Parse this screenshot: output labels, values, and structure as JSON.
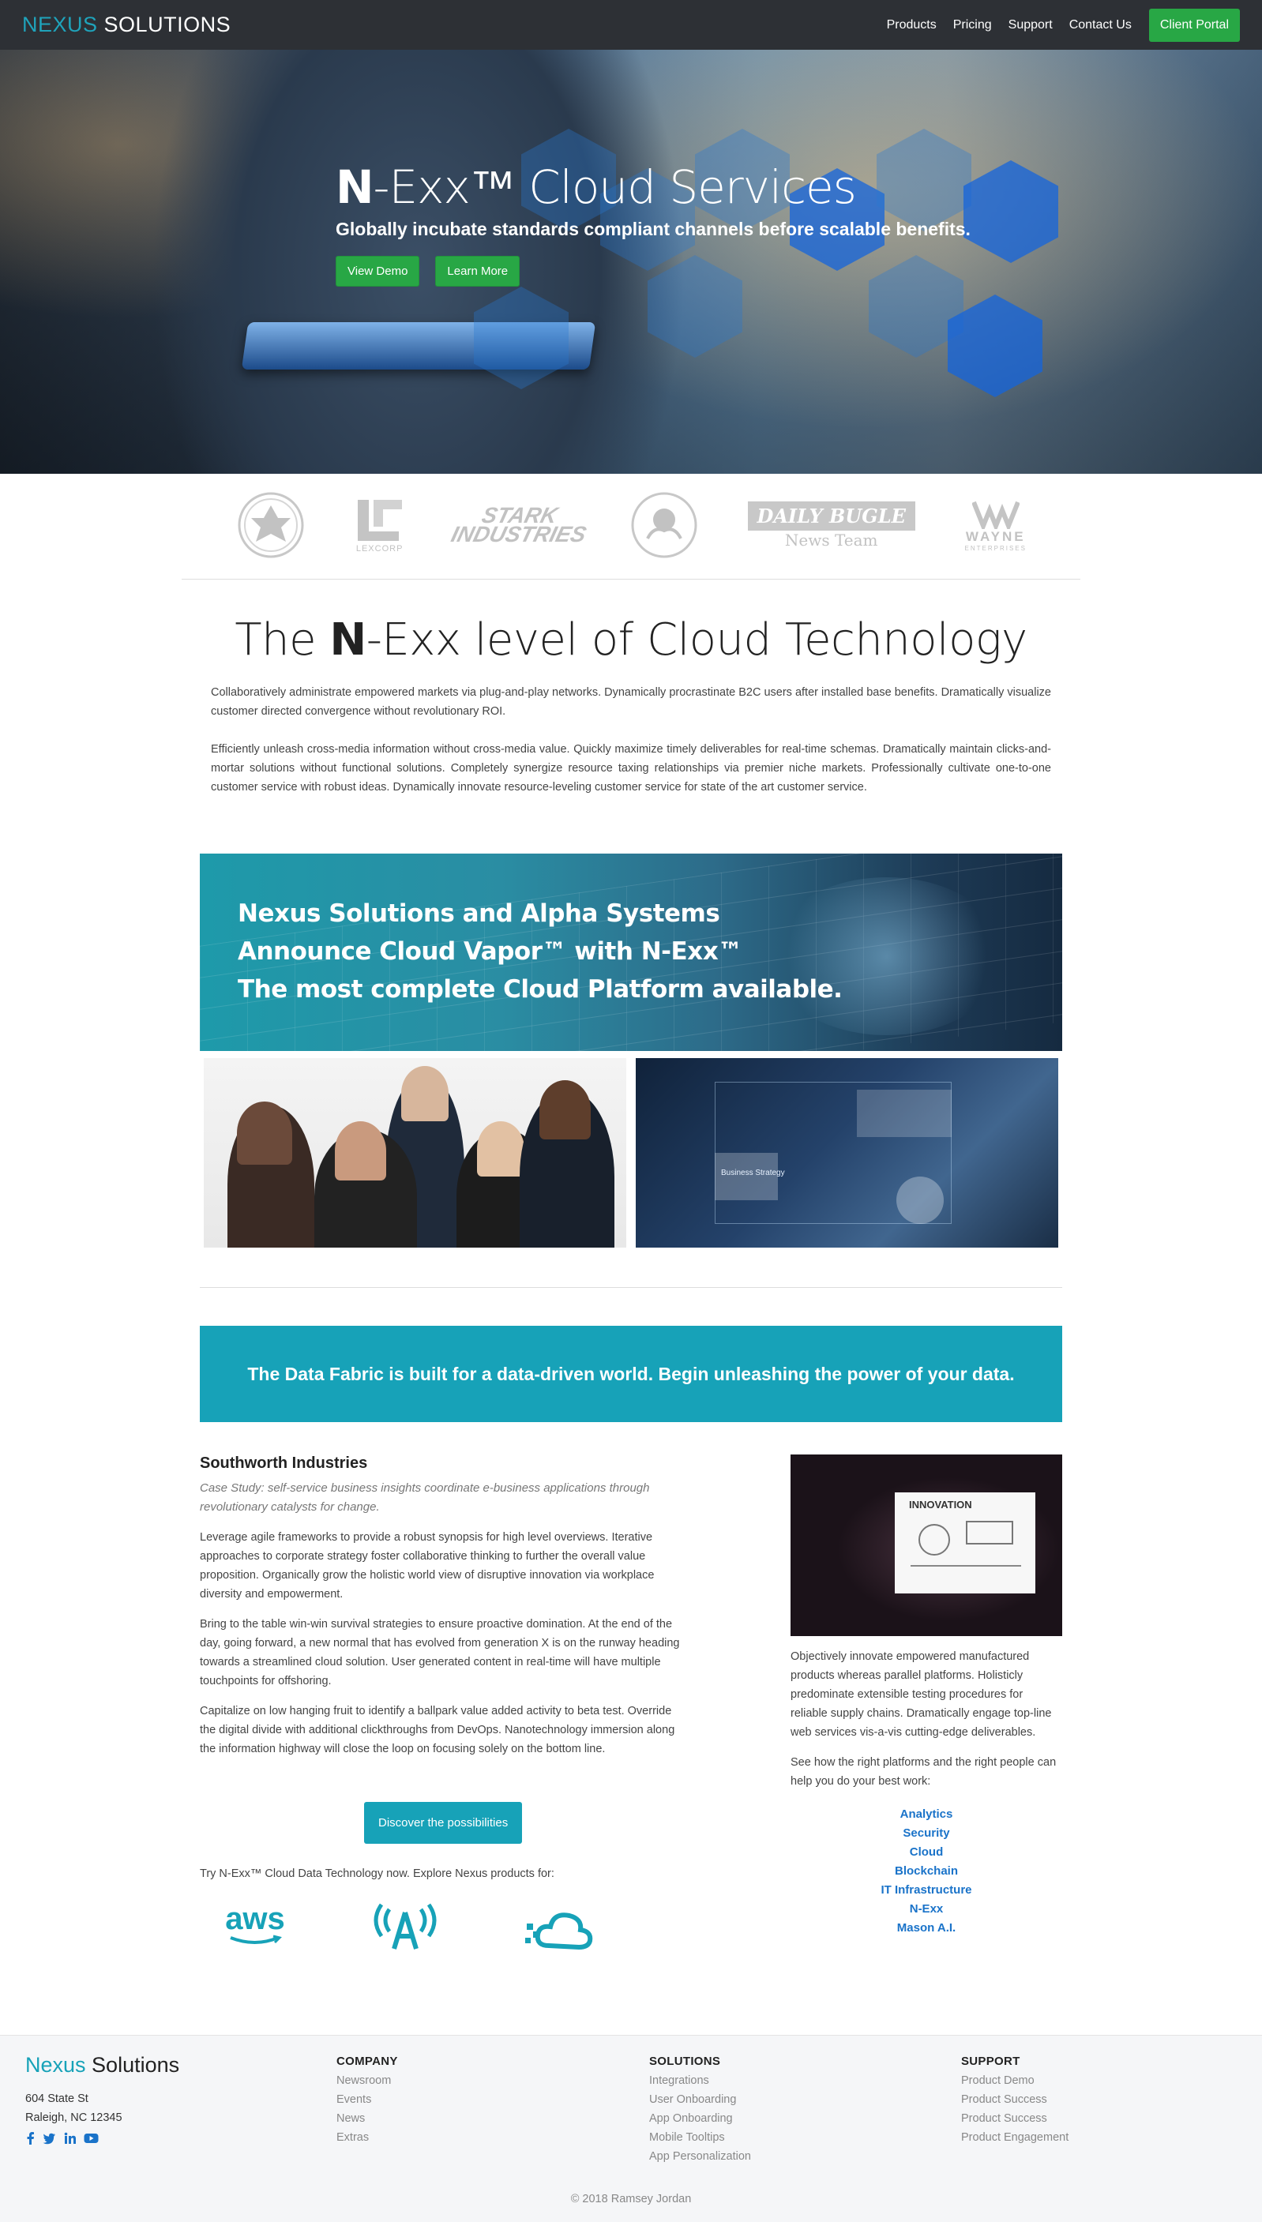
{
  "nav": {
    "brand_part1": "NEXUS",
    "brand_part2": "SOLUTIONS",
    "links": [
      "Products",
      "Pricing",
      "Support",
      "Contact Us"
    ],
    "portal_label": "Client Portal"
  },
  "hero": {
    "title_bold": "N",
    "title_rest": "-Exx™ Cloud Services",
    "subtitle": "Globally incubate standards compliant channels before scalable benefits.",
    "btn_demo": "View Demo",
    "btn_learn": "Learn More"
  },
  "logos": {
    "lexcorp": "LEXCORP",
    "stark": "STARK INDUSTRIES",
    "bugle": "DAILY BUGLE",
    "bugle_sub": "News Team",
    "wayne": "WAYNE",
    "wayne_sub": "ENTERPRISES"
  },
  "section": {
    "title_pre": "The ",
    "title_bold": "N",
    "title_rest": "-Exx level of Cloud Technology",
    "para1": "Collaboratively administrate empowered markets via plug-and-play networks. Dynamically procrastinate B2C users after installed base benefits. Dramatically visualize customer directed convergence without revolutionary ROI.",
    "para2": "Efficiently unleash cross-media information without cross-media value. Quickly maximize timely deliverables for real-time schemas. Dramatically maintain clicks-and-mortar solutions without functional solutions. Completely synergize resource taxing relationships via premier niche markets. Professionally cultivate one-to-one customer service with robust ideas. Dynamically innovate resource-leveling customer service for state of the art customer service."
  },
  "banner": {
    "line1": "Nexus Solutions and Alpha Systems",
    "line2": "Announce Cloud Vapor™ with N-Exx™",
    "line3": "The most complete Cloud Platform available."
  },
  "photo2_label": "Business Strategy",
  "cta": {
    "text": "The Data Fabric is built for a data-driven world. Begin unleashing the power of your data."
  },
  "case": {
    "title": "Southworth Industries",
    "lead": "Case Study: self-service business insights coordinate e-business applications through revolutionary catalysts for change.",
    "p1": "Leverage agile frameworks to provide a robust synopsis for high level overviews. Iterative approaches to corporate strategy foster collaborative thinking to further the overall value proposition. Organically grow the holistic world view of disruptive innovation via workplace diversity and empowerment.",
    "p2": "Bring to the table win-win survival strategies to ensure proactive domination. At the end of the day, going forward, a new normal that has evolved from generation X is on the runway heading towards a streamlined cloud solution. User generated content in real-time will have multiple touchpoints for offshoring.",
    "p3": "Capitalize on low hanging fruit to identify a ballpark value added activity to beta test. Override the digital divide with additional clickthroughs from DevOps. Nanotechnology immersion along the information highway will close the loop on focusing solely on the bottom line.",
    "btn": "Discover the possibilities",
    "try": "Try N-Exx™ Cloud Data Technology now. Explore Nexus products for:",
    "aws": "aws"
  },
  "sidebar": {
    "board_label": "INNOVATION",
    "p1": "Objectively innovate empowered manufactured products whereas parallel platforms. Holisticly predominate extensible testing procedures for reliable supply chains. Dramatically engage top-line web services vis-a-vis cutting-edge deliverables.",
    "p2": "See how the right platforms and the right people can help you do your best work:",
    "links": [
      "Analytics",
      "Security",
      "Cloud",
      "Blockchain",
      "IT Infrastructure",
      "N-Exx",
      "Mason A.I."
    ]
  },
  "footer": {
    "brand_part1": "Nexus",
    "brand_part2": "Solutions",
    "address1": "604 State St",
    "address2": "Raleigh, NC 12345",
    "company": {
      "heading": "COMPANY",
      "links": [
        "Newsroom",
        "Events",
        "News",
        "Extras"
      ]
    },
    "solutions": {
      "heading": "SOLUTIONS",
      "links": [
        "Integrations",
        "User Onboarding",
        "App Onboarding",
        "Mobile Tooltips",
        "App Personalization"
      ]
    },
    "support": {
      "heading": "SUPPORT",
      "links": [
        "Product Demo",
        "Product Success",
        "Product Success",
        "Product Engagement"
      ]
    },
    "copyright": "© 2018 Ramsey Jordan"
  },
  "colors": {
    "teal": "#17a2b8",
    "green": "#28a745",
    "navbar": "#2d3035",
    "link_blue": "#1a73c9"
  }
}
